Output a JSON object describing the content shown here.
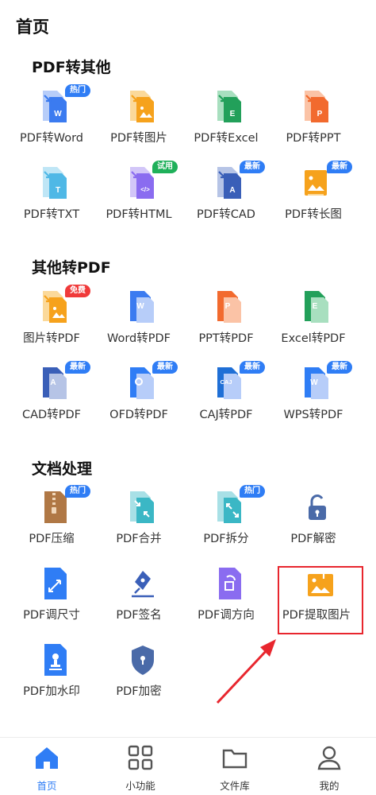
{
  "page_title": "首页",
  "sections": [
    {
      "title": "PDF转其他",
      "items": [
        {
          "label": "PDF转Word",
          "icon": "pdf-to-word-icon",
          "badge": "热门"
        },
        {
          "label": "PDF转图片",
          "icon": "pdf-to-image-icon",
          "badge": ""
        },
        {
          "label": "PDF转Excel",
          "icon": "pdf-to-excel-icon",
          "badge": ""
        },
        {
          "label": "PDF转PPT",
          "icon": "pdf-to-ppt-icon",
          "badge": ""
        },
        {
          "label": "PDF转TXT",
          "icon": "pdf-to-txt-icon",
          "badge": ""
        },
        {
          "label": "PDF转HTML",
          "icon": "pdf-to-html-icon",
          "badge": "试用"
        },
        {
          "label": "PDF转CAD",
          "icon": "pdf-to-cad-icon",
          "badge": "最新"
        },
        {
          "label": "PDF转长图",
          "icon": "pdf-to-long-image-icon",
          "badge": "最新"
        }
      ]
    },
    {
      "title": "其他转PDF",
      "items": [
        {
          "label": "图片转PDF",
          "icon": "image-to-pdf-icon",
          "badge": "免费"
        },
        {
          "label": "Word转PDF",
          "icon": "word-to-pdf-icon",
          "badge": ""
        },
        {
          "label": "PPT转PDF",
          "icon": "ppt-to-pdf-icon",
          "badge": ""
        },
        {
          "label": "Excel转PDF",
          "icon": "excel-to-pdf-icon",
          "badge": ""
        },
        {
          "label": "CAD转PDF",
          "icon": "cad-to-pdf-icon",
          "badge": "最新"
        },
        {
          "label": "OFD转PDF",
          "icon": "ofd-to-pdf-icon",
          "badge": "最新"
        },
        {
          "label": "CAJ转PDF",
          "icon": "caj-to-pdf-icon",
          "badge": "最新"
        },
        {
          "label": "WPS转PDF",
          "icon": "wps-to-pdf-icon",
          "badge": "最新"
        }
      ]
    },
    {
      "title": "文档处理",
      "items": [
        {
          "label": "PDF压缩",
          "icon": "pdf-compress-icon",
          "badge": "热门"
        },
        {
          "label": "PDF合并",
          "icon": "pdf-merge-icon",
          "badge": ""
        },
        {
          "label": "PDF拆分",
          "icon": "pdf-split-icon",
          "badge": "热门"
        },
        {
          "label": "PDF解密",
          "icon": "unlock-icon",
          "badge": ""
        },
        {
          "label": "PDF调尺寸",
          "icon": "pdf-resize-icon",
          "badge": ""
        },
        {
          "label": "PDF签名",
          "icon": "pen-nib-icon",
          "badge": ""
        },
        {
          "label": "PDF调方向",
          "icon": "pdf-rotate-icon",
          "badge": ""
        },
        {
          "label": "PDF提取图片",
          "icon": "extract-image-icon",
          "badge": ""
        },
        {
          "label": "PDF加水印",
          "icon": "watermark-stamp-icon",
          "badge": ""
        },
        {
          "label": "PDF加密",
          "icon": "shield-lock-icon",
          "badge": ""
        }
      ]
    }
  ],
  "nav": [
    {
      "label": "首页",
      "icon": "home-icon"
    },
    {
      "label": "小功能",
      "icon": "grid-icon"
    },
    {
      "label": "文件库",
      "icon": "folder-icon"
    },
    {
      "label": "我的",
      "icon": "user-icon"
    }
  ],
  "colors": {
    "primary": "#2f7df5",
    "word": "#3b7bf0",
    "orange": "#f6a21c",
    "excel": "#22a05a",
    "ppt": "#f26a2e",
    "txt": "#4fb8e6",
    "html": "#8a6cf0",
    "cad": "#3a5fb8",
    "compress": "#b07845",
    "highlight": "#e8262e"
  }
}
